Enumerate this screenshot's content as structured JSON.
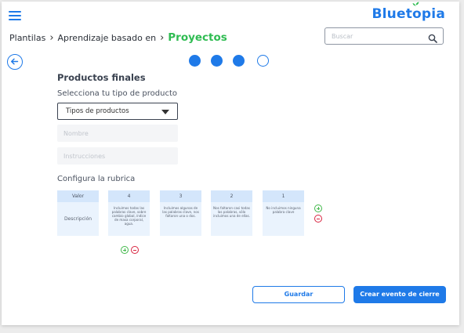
{
  "brand": {
    "name_part1": "Bluet",
    "name_sprout": "o",
    "name_part2": "pia",
    "color": "#1f7ae8"
  },
  "breadcrumb": {
    "items": [
      "Plantilas",
      "Aprendizaje basado en"
    ],
    "current": "Proyectos",
    "current_color": "#2fbc52"
  },
  "search": {
    "placeholder": "Buscar",
    "icon": "search-icon"
  },
  "stepper": {
    "total": 4,
    "completed": 3
  },
  "form": {
    "section_title": "Productos finales",
    "product_type_label": "Selecciona tu tipo de producto",
    "product_type_value": "Tipos de productos",
    "name_placeholder": "Nombre",
    "instructions_placeholder": "Instrucciones",
    "rubric_label": "Configura la rubrica"
  },
  "rubric": {
    "row_header": "Valor",
    "row_label": "Descripción",
    "columns": [
      {
        "value": "4",
        "description": "Incluimos todas las palabras clave, sobre cambio global, índice de masa corporal, agua."
      },
      {
        "value": "3",
        "description": "Incluimos algunas de las palabras clave, nos faltaron una o dos."
      },
      {
        "value": "2",
        "description": "Nos faltaron casi todas las palabras, sólo incluimos una de ellas."
      },
      {
        "value": "1",
        "description": "No incluimos ninguna palabra clave"
      }
    ]
  },
  "actions": {
    "save_label": "Guardar",
    "create_label": "Crear evento de cierre"
  },
  "colors": {
    "accent": "#1f7ae8",
    "add": "#41b84a",
    "remove": "#d8233f"
  }
}
